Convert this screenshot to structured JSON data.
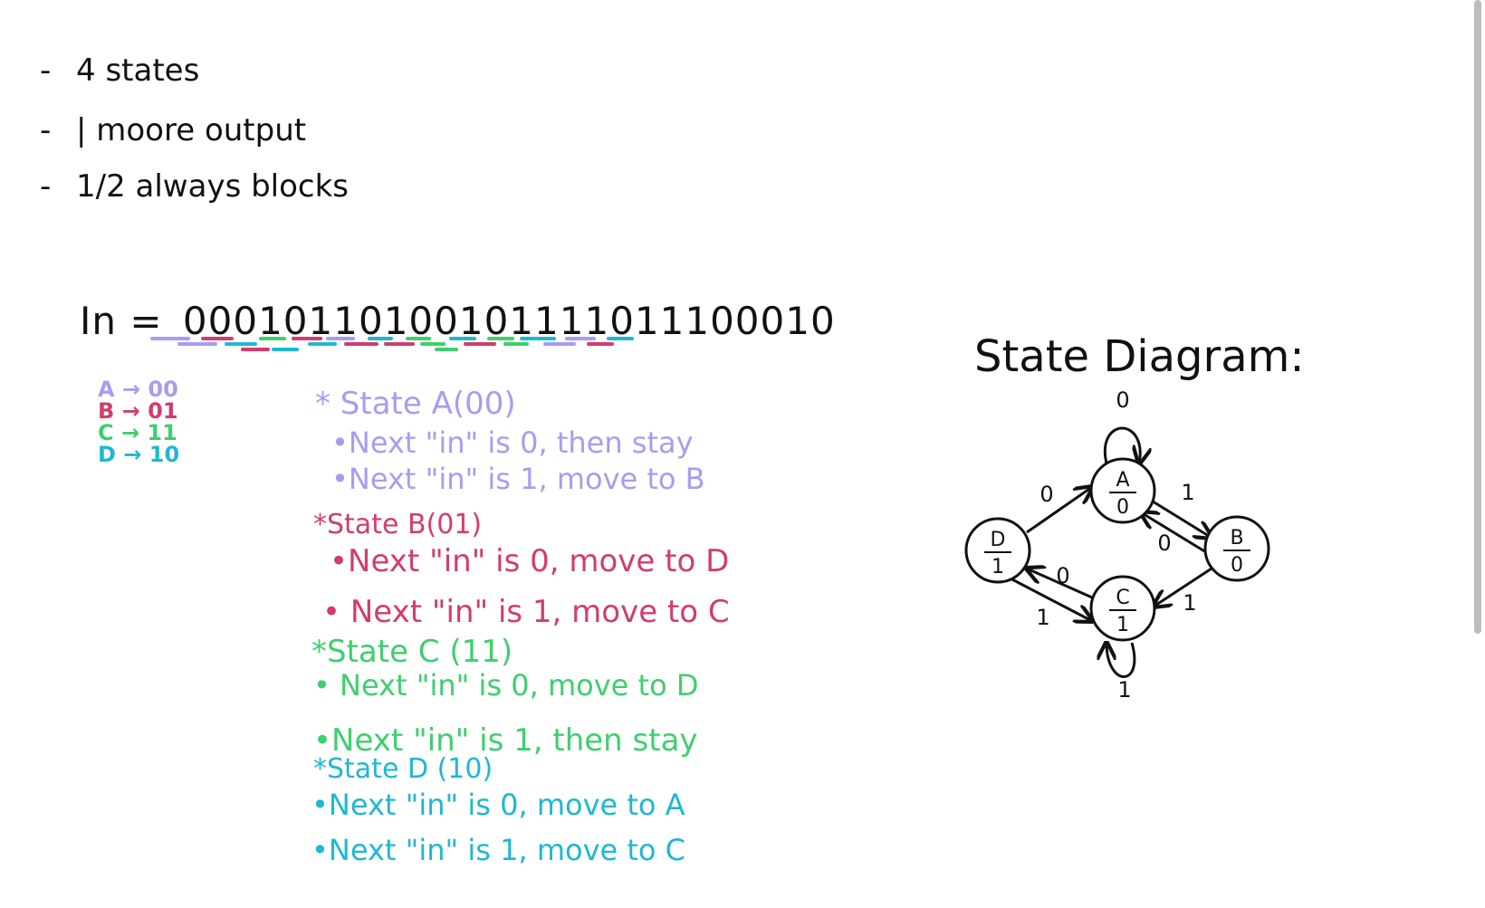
{
  "colors": {
    "ink": "#111111",
    "state_a": "#a99cf0",
    "state_b": "#d23c6e",
    "state_c": "#3ecf6e",
    "state_d": "#1fb7d4"
  },
  "requirements": [
    {
      "dash": "-",
      "text": "4 states"
    },
    {
      "dash": "-",
      "text": "| moore output"
    },
    {
      "dash": "-",
      "text": "1/2 always blocks"
    }
  ],
  "input_sequence": {
    "label": "In =",
    "bits": "00010110100101111011100010"
  },
  "encoding_legend": [
    {
      "text": "A → 00",
      "color": "#a99cf0"
    },
    {
      "text": "B → 01",
      "color": "#d23c6e"
    },
    {
      "text": "C → 11",
      "color": "#3ecf6e"
    },
    {
      "text": "D → 10",
      "color": "#1fb7d4"
    }
  ],
  "state_descriptions": [
    {
      "heading": "* State A(00)",
      "color": "#a99cf0",
      "items": [
        "•Next \"in\" is 0, then stay",
        "•Next \"in\" is 1, move to B"
      ]
    },
    {
      "heading": "*State B(01)",
      "color": "#d23c6e",
      "items": [
        "•Next \"in\" is 0, move to D",
        "• Next \"in\" is 1, move to C"
      ]
    },
    {
      "heading": "*State C (11)",
      "color": "#3ecf6e",
      "items": [
        "• Next \"in\" is 0, move to D",
        "•Next \"in\" is 1, then stay"
      ]
    },
    {
      "heading": "*State D (10)",
      "color": "#1fb7d4",
      "items": [
        "•Next \"in\" is 0, move to A",
        "•Next \"in\" is 1, move to C"
      ]
    }
  ],
  "state_diagram": {
    "title": "State Diagram:",
    "nodes": [
      {
        "id": "A",
        "name": "A",
        "output": "0"
      },
      {
        "id": "B",
        "name": "B",
        "output": "0"
      },
      {
        "id": "C",
        "name": "C",
        "output": "1"
      },
      {
        "id": "D",
        "name": "D",
        "output": "1"
      }
    ],
    "transitions": [
      {
        "from": "A",
        "to": "A",
        "label": "0"
      },
      {
        "from": "A",
        "to": "B",
        "label": "1"
      },
      {
        "from": "B",
        "to": "A",
        "label": "0"
      },
      {
        "from": "B",
        "to": "C",
        "label": "1"
      },
      {
        "from": "C",
        "to": "C",
        "label": "1"
      },
      {
        "from": "C",
        "to": "D",
        "label": "0"
      },
      {
        "from": "D",
        "to": "A",
        "label": "0"
      },
      {
        "from": "D",
        "to": "C",
        "label": "1"
      }
    ]
  }
}
